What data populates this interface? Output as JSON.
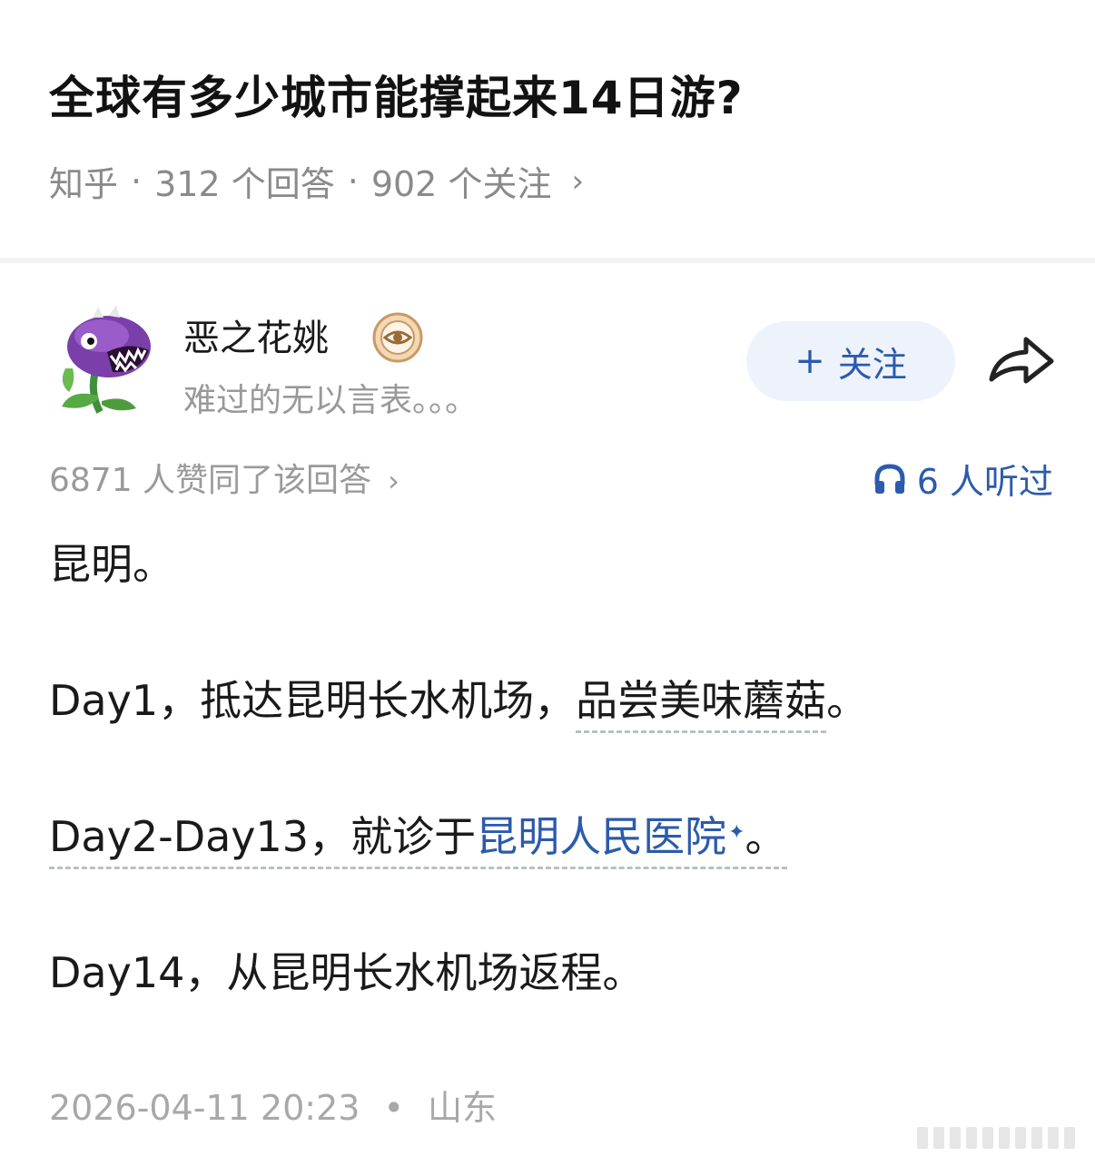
{
  "question": {
    "title": "全球有多少城市能撑起来14日游?",
    "source": "知乎",
    "answers": "312 个回答",
    "followers": "902 个关注"
  },
  "author": {
    "name": "恶之花姚",
    "bio": "难过的无以言表。。。",
    "follow_label": "关注"
  },
  "stats": {
    "upvotes": "6871 人赞同了该回答",
    "listens": "6 人听过"
  },
  "answer": {
    "p1": "昆明。",
    "p2_prefix": "Day1，抵达昆明长水机场，",
    "p2_underlined": "品尝美味蘑菇",
    "p2_suffix": "。",
    "p3_prefix": "Day2-Day13，就诊于",
    "p3_link": "昆明人民医院",
    "p3_suffix": "。",
    "p4": "Day14，从昆明长水机场返程。"
  },
  "footer": {
    "datetime": "2026-04-11 20:23",
    "location": "山东"
  },
  "colors": {
    "accent_blue": "#2c5bad",
    "follow_bg": "#eef3fb",
    "meta_gray": "#8a8a8a"
  },
  "icons": {
    "badge": "eye-badge-icon",
    "share": "share-arrow-icon",
    "listen": "headphones-icon"
  }
}
